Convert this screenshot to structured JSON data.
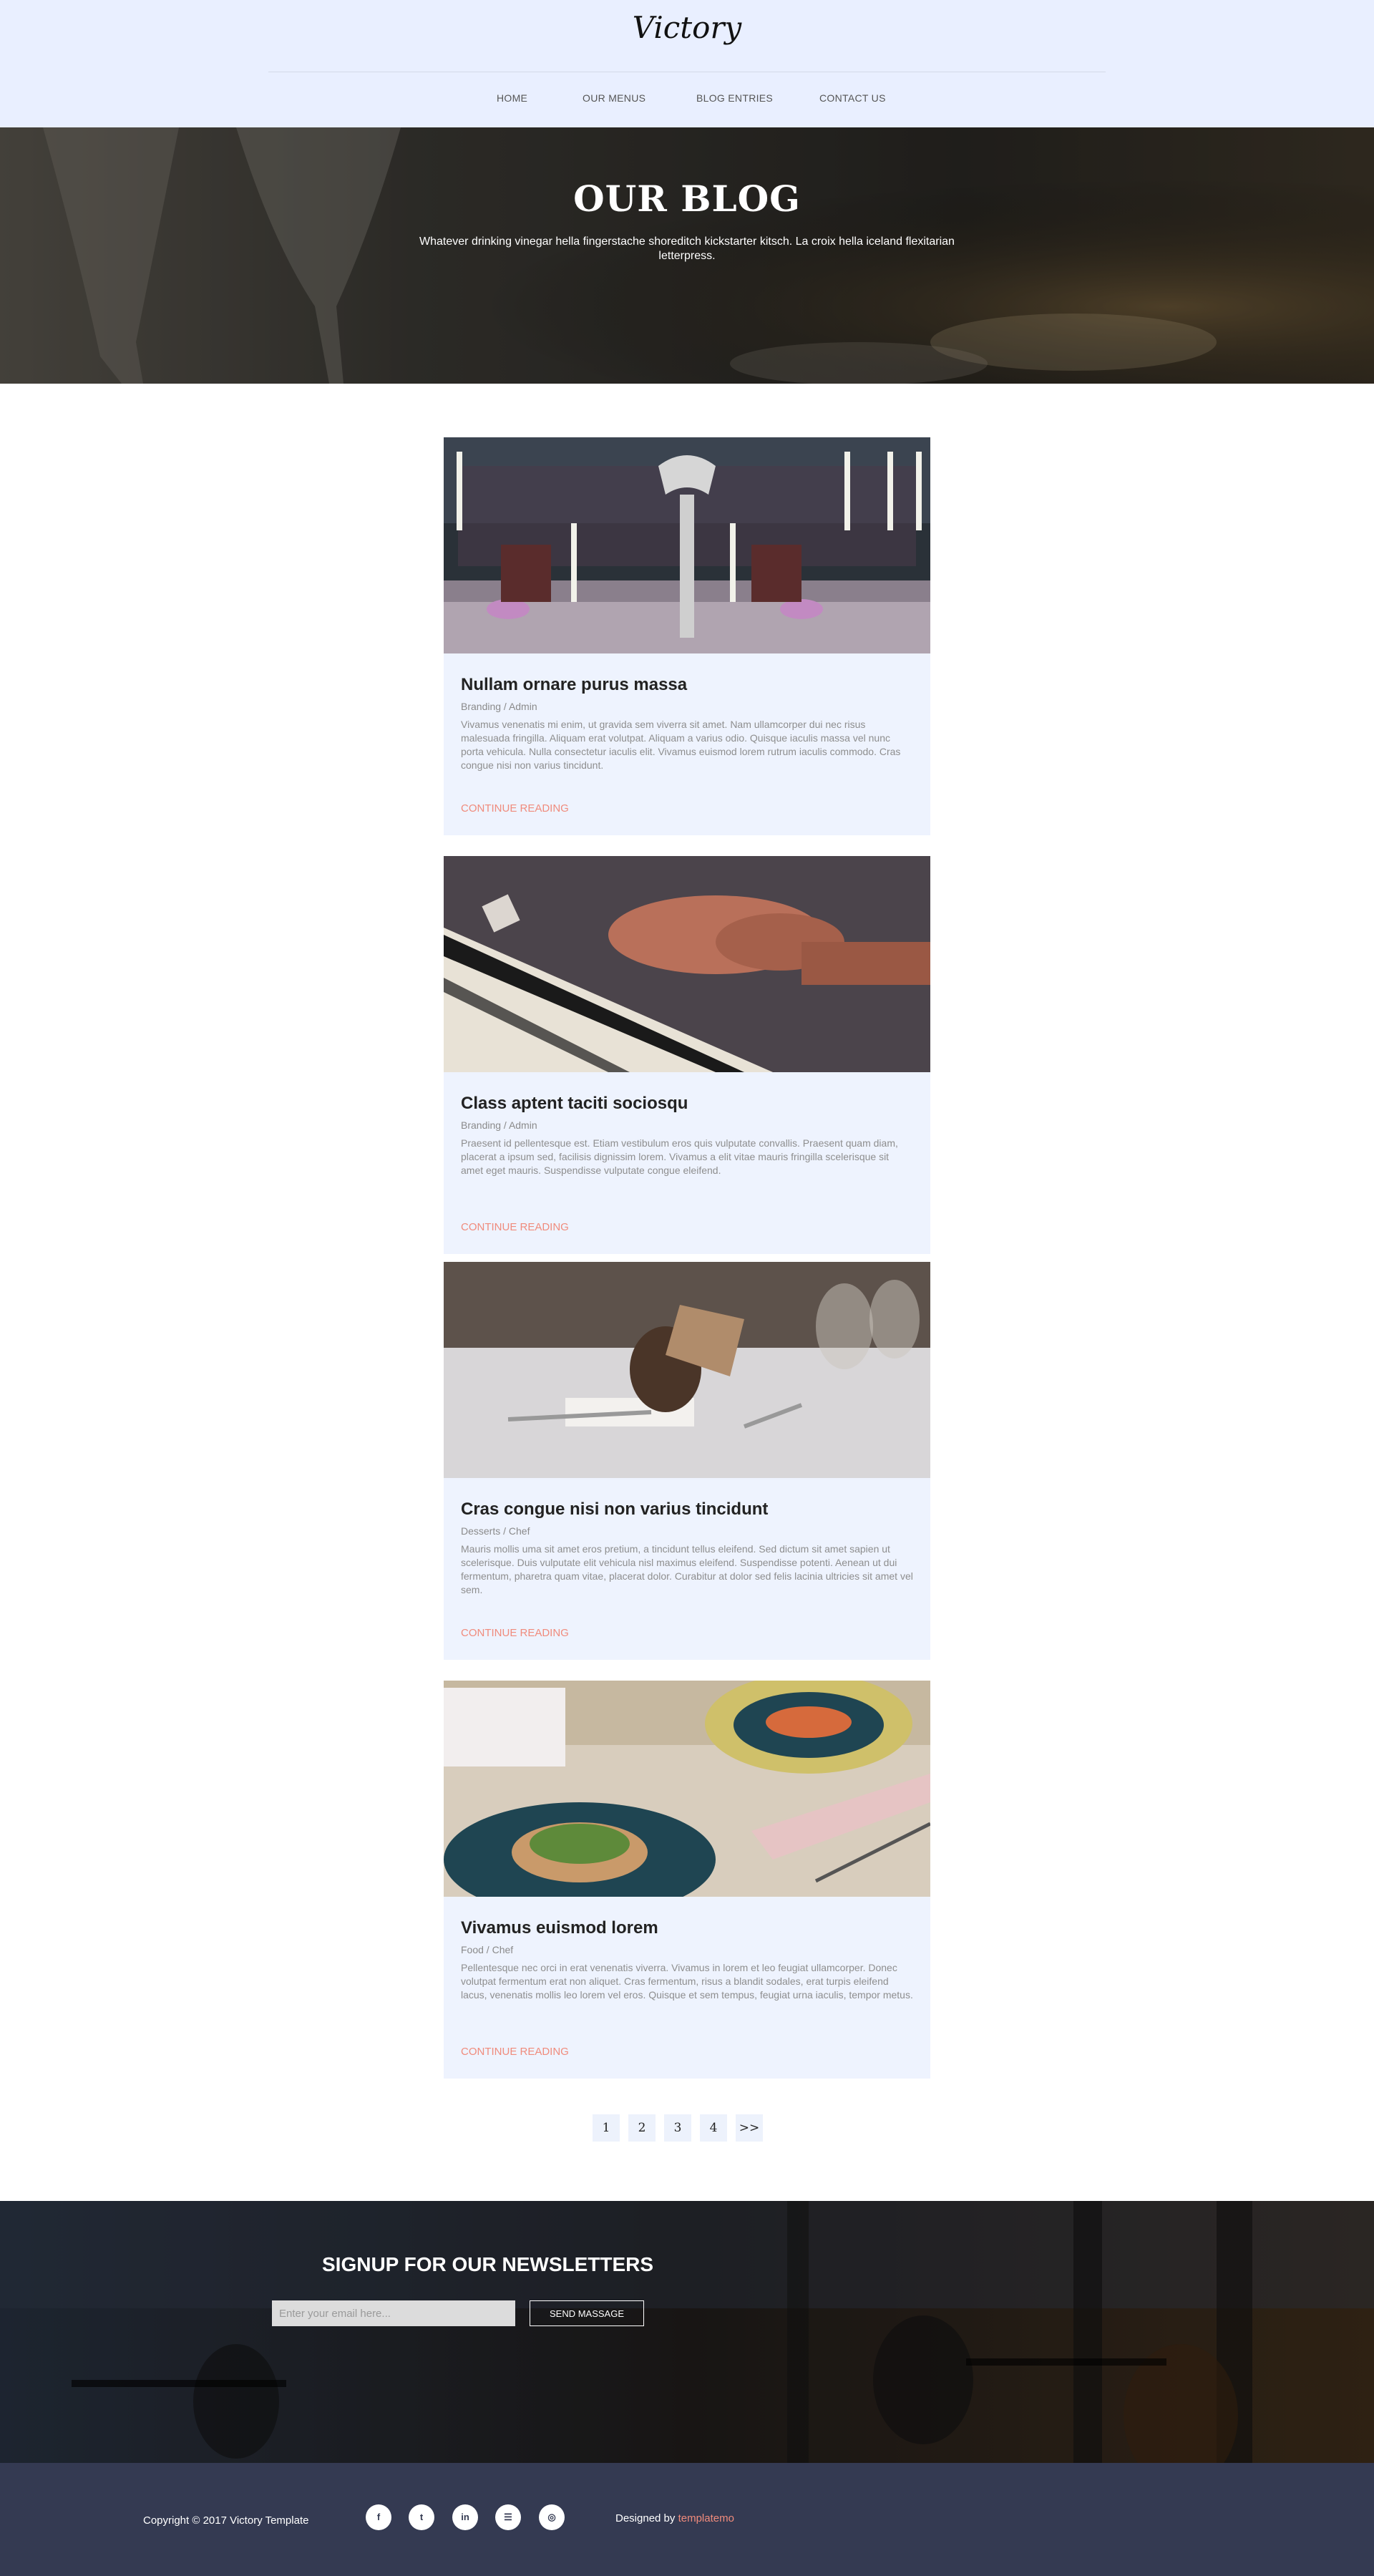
{
  "header": {
    "logo": "Victory",
    "nav": [
      {
        "label": "HOME"
      },
      {
        "label": "OUR MENUS"
      },
      {
        "label": "BLOG ENTRIES"
      },
      {
        "label": "CONTACT US"
      }
    ]
  },
  "hero": {
    "title": "OUR BLOG",
    "subtitle": "Whatever drinking vinegar hella fingerstache shoreditch kickstarter kitsch. La croix hella iceland flexitarian letterpress."
  },
  "posts": [
    {
      "title": "Nullam ornare purus massa",
      "meta": "Branding / Admin",
      "excerpt": "Vivamus venenatis mi enim, ut gravida sem viverra sit amet. Nam ullamcorper dui nec risus malesuada fringilla. Aliquam erat volutpat. Aliquam a varius odio. Quisque iaculis massa vel nunc porta vehicula. Nulla consectetur iaculis elit. Vivamus euismod lorem rutrum iaculis commodo. Cras congue nisi non varius tincidunt.",
      "link": "CONTINUE READING"
    },
    {
      "title": "Class aptent taciti sociosqu",
      "meta": "Branding / Admin",
      "excerpt": "Praesent id pellentesque est. Etiam vestibulum eros quis vulputate convallis. Praesent quam diam, placerat a ipsum sed, facilisis dignissim lorem. Vivamus a elit vitae mauris fringilla scelerisque sit amet eget mauris. Suspendisse vulputate congue eleifend.",
      "link": "CONTINUE READING"
    },
    {
      "title": "Cras congue nisi non varius tincidunt",
      "meta": "Desserts / Chef",
      "excerpt": "Mauris mollis uma sit amet eros pretium, a tincidunt tellus eleifend. Sed dictum sit amet sapien ut scelerisque. Duis vulputate elit vehicula nisl maximus eleifend. Suspendisse potenti. Aenean ut dui fermentum, pharetra quam vitae, placerat dolor. Curabitur at dolor sed felis lacinia ultricies sit amet vel sem.",
      "link": "CONTINUE READING"
    },
    {
      "title": "Vivamus euismod lorem",
      "meta": "Food / Chef",
      "excerpt": "Pellentesque nec orci in erat venenatis viverra. Vivamus in lorem et leo feugiat ullamcorper. Donec volutpat fermentum erat non aliquet. Cras fermentum, risus a blandit sodales, erat turpis eleifend lacus, venenatis mollis leo lorem vel eros. Quisque et sem tempus, feugiat urna iaculis, tempor metus.",
      "link": "CONTINUE READING"
    }
  ],
  "pagination": {
    "pages": [
      "1",
      "2",
      "3",
      "4"
    ],
    "next": ">>"
  },
  "newsletter": {
    "title": "SIGNUP FOR OUR NEWSLETTERS",
    "placeholder": "Enter your email here...",
    "button": "SEND MASSAGE"
  },
  "footer": {
    "copyright": "Copyright © 2017 Victory Template",
    "designed_prefix": "Designed by",
    "designed_link": "templatemo",
    "social": [
      {
        "icon": "facebook-icon",
        "glyph": "f"
      },
      {
        "icon": "twitter-icon",
        "glyph": "t"
      },
      {
        "icon": "linkedin-icon",
        "glyph": "in"
      },
      {
        "icon": "rss-icon",
        "glyph": "☰"
      },
      {
        "icon": "dribbble-icon",
        "glyph": "◎"
      }
    ]
  },
  "colors": {
    "header_bg": "#e9efff",
    "card_bg": "#eef3fe",
    "accent": "#f08b7c",
    "footer_bg": "#343a52"
  }
}
